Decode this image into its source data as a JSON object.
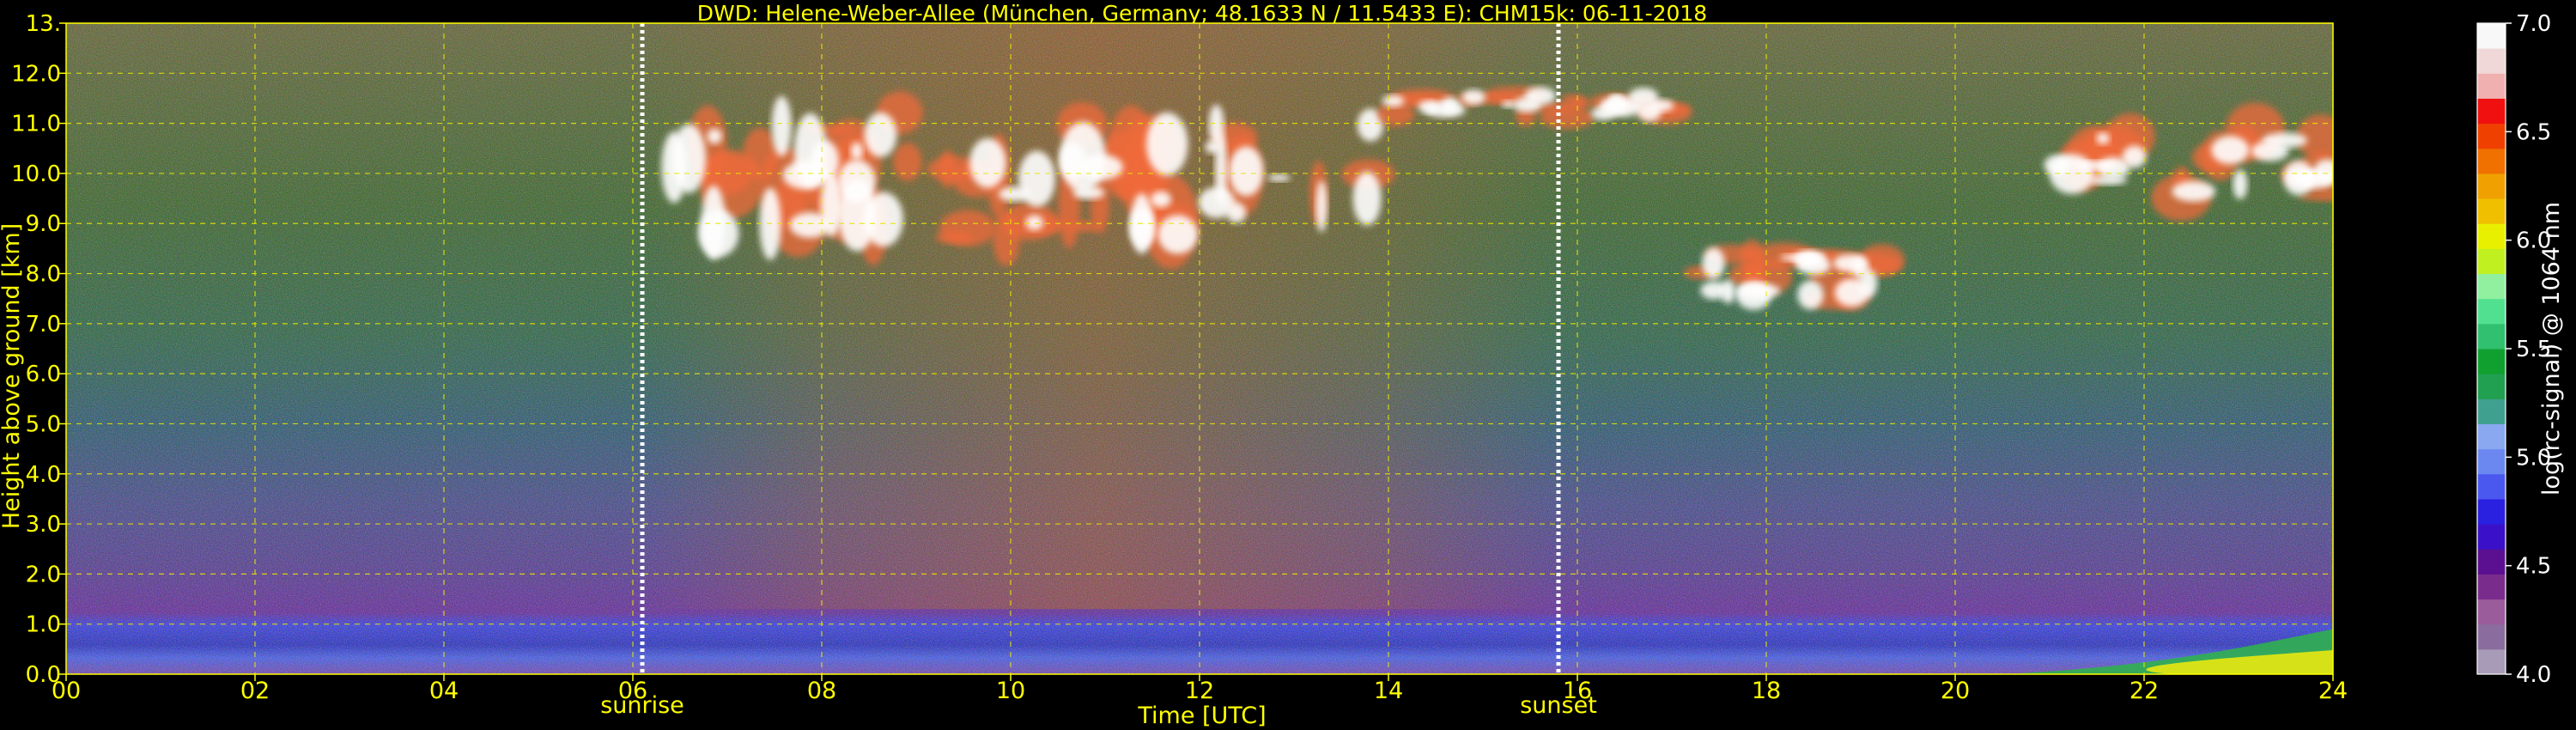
{
  "chart_data": {
    "type": "heatmap",
    "title": "DWD: Helene-Weber-Allee (München, Germany; 48.1633 N / 11.5433 E):    CHM15k: 06-11-2018",
    "xlabel": "Time [UTC]",
    "ylabel": "Height above ground [km]",
    "xlim": [
      0,
      24
    ],
    "ylim": [
      0,
      13
    ],
    "x_ticks": [
      "00",
      "02",
      "04",
      "06",
      "08",
      "10",
      "12",
      "14",
      "16",
      "18",
      "20",
      "22",
      "24"
    ],
    "x_tick_values": [
      0,
      2,
      4,
      6,
      8,
      10,
      12,
      14,
      16,
      18,
      20,
      22,
      24
    ],
    "y_ticks": [
      "0.0",
      "1.0",
      "2.0",
      "3.0",
      "4.0",
      "5.0",
      "6.0",
      "7.0",
      "8.0",
      "9.0",
      "10.0",
      "11.0",
      "12.0",
      "13."
    ],
    "y_tick_values": [
      0,
      1,
      2,
      3,
      4,
      5,
      6,
      7,
      8,
      9,
      10,
      11,
      12,
      13
    ],
    "grid": true,
    "markers": [
      {
        "label": "sunrise",
        "time_utc": 6.1
      },
      {
        "label": "sunset",
        "time_utc": 15.8
      }
    ],
    "colorbar": {
      "label": "log(rc-signal) @ 1064 nm",
      "range": [
        4.0,
        7.0
      ],
      "ticks": [
        "4.0",
        "4.5",
        "5.0",
        "5.5",
        "6.0",
        "6.5",
        "7.0"
      ],
      "tick_values": [
        4.0,
        4.5,
        5.0,
        5.5,
        6.0,
        6.5,
        7.0
      ],
      "colors": [
        "#a89bb8",
        "#8a6d9e",
        "#9a5c9a",
        "#7a2c8c",
        "#5a1090",
        "#3a10c8",
        "#2a20e0",
        "#4a58f0",
        "#6a88f0",
        "#8aa8f0",
        "#40a090",
        "#20a050",
        "#10a030",
        "#30c070",
        "#50e090",
        "#90f0a0",
        "#c0f020",
        "#e8f000",
        "#f0c000",
        "#f0a000",
        "#f07000",
        "#f04000",
        "#f01010",
        "#f0b0b0",
        "#f0d8d8",
        "#f8f8f8"
      ]
    },
    "features": [
      {
        "type": "cirrus cloud",
        "time_utc": [
          6.1,
          14.0
        ],
        "height_km": [
          8.0,
          11.8
        ],
        "log_signal": [
          6.0,
          7.0
        ]
      },
      {
        "type": "cirrus cloud",
        "time_utc": [
          14.0,
          17.0
        ],
        "height_km": [
          11.0,
          11.7
        ],
        "log_signal": [
          6.0,
          7.0
        ]
      },
      {
        "type": "cirrus cloud",
        "time_utc": [
          17.3,
          19.3
        ],
        "height_km": [
          7.2,
          8.6
        ],
        "log_signal": [
          6.0,
          7.0
        ]
      },
      {
        "type": "cirrus cloud",
        "time_utc": [
          20.8,
          24.0
        ],
        "height_km": [
          9.2,
          11.2
        ],
        "log_signal": [
          6.0,
          7.0
        ]
      },
      {
        "type": "boundary layer",
        "time_utc": [
          20.5,
          24.0
        ],
        "height_km": [
          0.0,
          0.9
        ],
        "log_signal": [
          5.0,
          5.9
        ]
      }
    ]
  },
  "colors": {
    "text": "#ffff00",
    "grid": "#e8e800",
    "marker": "#ffffff",
    "frame": "#ffff00"
  }
}
